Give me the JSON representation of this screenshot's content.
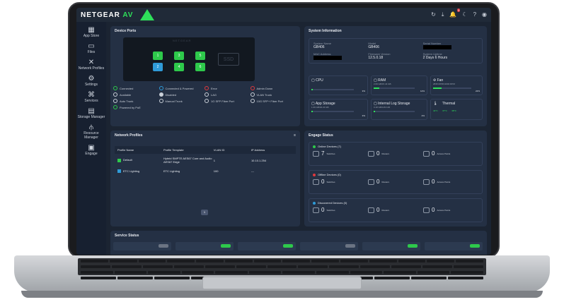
{
  "brand": {
    "name": "NETGEAR",
    "suffix": "AV",
    "accent": "#2ee05a"
  },
  "topbar": {
    "notification_count": "5"
  },
  "sidebar": {
    "items": [
      {
        "label": "App Store",
        "icon": "app-store-icon"
      },
      {
        "label": "Files",
        "icon": "folder-icon"
      },
      {
        "label": "Network Profiles",
        "icon": "network-icon"
      },
      {
        "label": "Settings",
        "icon": "gear-icon"
      },
      {
        "label": "Services",
        "icon": "services-icon"
      },
      {
        "label": "Storage Manager",
        "icon": "storage-icon"
      },
      {
        "label": "Resource Manager",
        "icon": "resource-icon"
      },
      {
        "label": "Engage",
        "icon": "engage-icon"
      }
    ]
  },
  "device_ports": {
    "title": "Device Ports",
    "device_brand": "NETGEAR",
    "ssd_label": "SSD",
    "ports": [
      "1",
      "2",
      "3",
      "4",
      "5",
      "6"
    ],
    "legend": [
      {
        "label": "Connected",
        "color": "#2ec94b"
      },
      {
        "label": "Connected & Powered",
        "color": "#2f9bd8"
      },
      {
        "label": "Error",
        "color": "#e0393e"
      },
      {
        "label": "Admin Down",
        "color": "#e0393e"
      },
      {
        "label": "Available",
        "color": "#c9cfd8"
      },
      {
        "label": "Disabled",
        "color": "#c9cfd8"
      },
      {
        "label": "LAG",
        "color": "#c9cfd8"
      },
      {
        "label": "VLAN Trunk",
        "color": "#c9cfd8"
      },
      {
        "label": "Auto Trunk",
        "color": "#c9cfd8"
      },
      {
        "label": "Manual Trunk",
        "color": "#c9cfd8"
      },
      {
        "label": "1G SFP Fiber Port",
        "color": "#c9cfd8"
      },
      {
        "label": "10G SFP+ Fiber Port",
        "color": "#c9cfd8"
      },
      {
        "label": "Powered by PoE",
        "color": "#2ec94b"
      }
    ]
  },
  "system_info": {
    "title": "System Information",
    "fields": [
      {
        "label": "System Name",
        "value": "GB406"
      },
      {
        "label": "Model",
        "value": "GB406"
      },
      {
        "label": "Serial Number",
        "value": ""
      },
      {
        "label": "MAC Address",
        "value": ""
      },
      {
        "label": "Firmware Version",
        "value": "12.5.0.18"
      },
      {
        "label": "System Uptime",
        "value": "2 Days 6 Hours"
      }
    ],
    "metrics": {
      "cpu": {
        "label": "CPU",
        "percent": "3%",
        "fraction": 0.03
      },
      "ram": {
        "label": "RAM",
        "detail": "2.09 GB/15.44 GB",
        "percent": "14%",
        "fraction": 0.14
      },
      "fan": {
        "label": "Fan",
        "detail": "2835 RPM/13000 RPM",
        "percent": "22%",
        "fraction": 0.22
      },
      "app_storage": {
        "label": "App Storage",
        "detail": "1.09 GB/40.23 GB",
        "percent": "3%",
        "fraction": 0.03
      },
      "log_storage": {
        "label": "Internal Log Storage",
        "detail": "0.18 GB/4.84 GB",
        "percent": "4%",
        "fraction": 0.04
      },
      "thermal": {
        "label": "Thermal",
        "temps": [
          "44°C",
          "37°C",
          "38°C"
        ]
      }
    }
  },
  "network_profiles": {
    "title": "Network Profiles",
    "columns": [
      "Profile Name",
      "Profile Template",
      "VLAN ID",
      "IP Address"
    ],
    "rows": [
      {
        "name": "Default",
        "template": "Hybrid SMPTE AES67 Core and Audio AES67 Edge",
        "vlan": "1",
        "ip": "10.10.1.254",
        "color": "#2ec94b"
      },
      {
        "name": "ETC Lighting",
        "template": "ETC Lighting",
        "vlan": "100",
        "ip": "---",
        "color": "#2f9bd8"
      }
    ],
    "page": "1"
  },
  "engage": {
    "title": "Engage Status",
    "groups": [
      {
        "label": "Online Devices (7)",
        "color": "#2ec94b",
        "switches": "7",
        "routers": "0",
        "aps": "0"
      },
      {
        "label": "Offline Devices (0)",
        "color": "#e0393e",
        "switches": "0",
        "routers": "0",
        "aps": "0"
      },
      {
        "label": "Discovered Devices (0)",
        "color": "#2f9bd8",
        "switches": "0",
        "routers": "0",
        "aps": "0"
      }
    ],
    "switches_label": "Switches",
    "routers_label": "Routers",
    "aps_label": "Access Points"
  },
  "service_status": {
    "title": "Service Status",
    "toggles": [
      "#6b7483",
      "#2ec94b",
      "#2ec94b",
      "#6b7483",
      "#2ec94b",
      "#2ec94b"
    ]
  }
}
